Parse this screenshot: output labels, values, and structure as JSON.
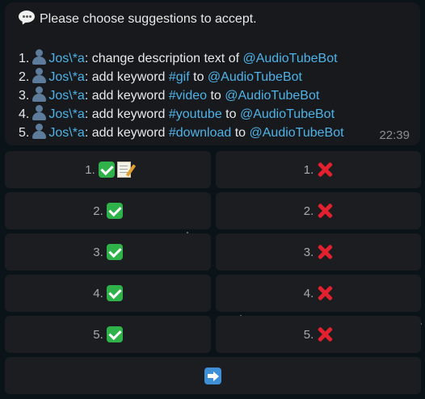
{
  "message": {
    "header": "Please choose suggestions to accept.",
    "items": [
      {
        "num": "1.",
        "user": "Jos\\*a",
        "sep": ": ",
        "pre": "change description text of ",
        "keyword": "",
        "mid": "",
        "bot": "@AudioTubeBot"
      },
      {
        "num": "2.",
        "user": "Jos\\*a",
        "sep": ": ",
        "pre": "add keyword ",
        "keyword": "#gif",
        "mid": " to ",
        "bot": "@AudioTubeBot"
      },
      {
        "num": "3.",
        "user": "Jos\\*a",
        "sep": ": ",
        "pre": "add keyword ",
        "keyword": "#video",
        "mid": " to ",
        "bot": "@AudioTubeBot"
      },
      {
        "num": "4.",
        "user": "Jos\\*a",
        "sep": ": ",
        "pre": "add keyword ",
        "keyword": "#youtube",
        "mid": " to ",
        "bot": "@AudioTubeBot"
      },
      {
        "num": "5.",
        "user": "Jos\\*a",
        "sep": ": ",
        "pre": "add keyword ",
        "keyword": "#download",
        "mid": " to ",
        "bot": "@AudioTubeBot"
      }
    ],
    "time": "22:39"
  },
  "keyboard": {
    "accept": [
      "1.",
      "2.",
      "3.",
      "4.",
      "5."
    ],
    "reject": [
      "1.",
      "2.",
      "3.",
      "4.",
      "5."
    ],
    "next_icon": "arrow-right-icon"
  },
  "colors": {
    "link": "#4fb3e8",
    "bubble": "#17191c",
    "button": "#1b1d20",
    "accept": "#2fb24a",
    "reject": "#e3202d",
    "next": "#3f8fd6"
  }
}
